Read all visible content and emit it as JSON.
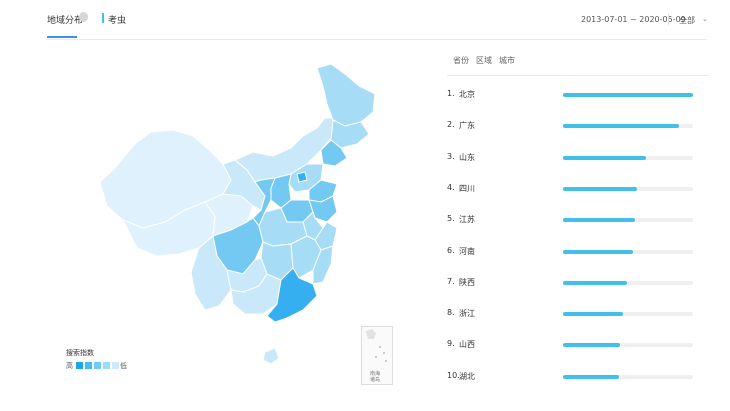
{
  "tabs": {
    "title": "地域分布",
    "keyword": "考虫"
  },
  "date_range": "2013-07-01 ~ 2020-05-09",
  "scope": "全部",
  "legend": {
    "title": "搜索指数",
    "high": "高",
    "low": "低",
    "colors": [
      "#1aa6ea",
      "#44bdf0",
      "#6ccdf5",
      "#9cdcf7",
      "#cbeafb"
    ]
  },
  "inset_label": "南海\n诸岛",
  "panel_tabs": [
    "省份",
    "区域",
    "城市"
  ],
  "ranking": [
    {
      "rank": "1.",
      "name": "北京",
      "value": 1.0
    },
    {
      "rank": "2.",
      "name": "广东",
      "value": 0.89
    },
    {
      "rank": "3.",
      "name": "山东",
      "value": 0.64
    },
    {
      "rank": "4.",
      "name": "四川",
      "value": 0.57
    },
    {
      "rank": "5.",
      "name": "江苏",
      "value": 0.55
    },
    {
      "rank": "6.",
      "name": "河南",
      "value": 0.54
    },
    {
      "rank": "7.",
      "name": "陕西",
      "value": 0.49
    },
    {
      "rank": "8.",
      "name": "浙江",
      "value": 0.46
    },
    {
      "rank": "9.",
      "name": "山西",
      "value": 0.44
    },
    {
      "rank": "10.",
      "name": "湖北",
      "value": 0.43
    }
  ],
  "map_colors": {
    "xlow": "#dff1fc",
    "low": "#c9e9fa",
    "mid": "#a6dcf6",
    "high": "#73c9f2",
    "top": "#35aff0",
    "edge": "#ffffff"
  }
}
